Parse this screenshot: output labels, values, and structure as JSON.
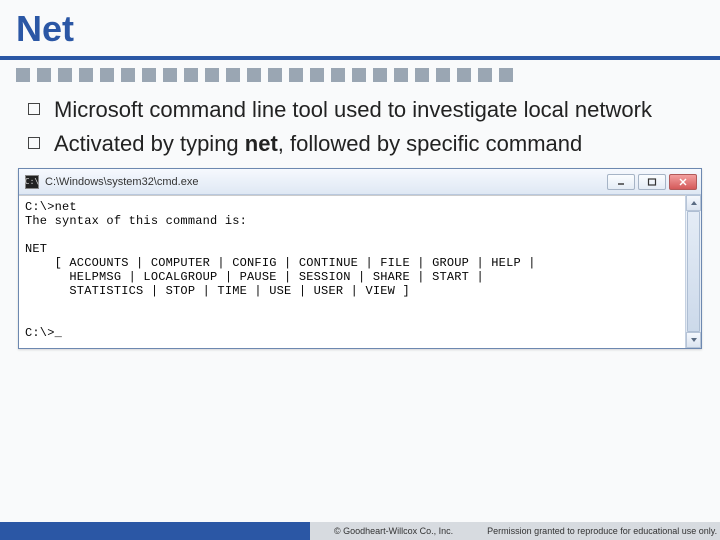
{
  "title": "Net",
  "decor": {
    "dot_count": 24
  },
  "bullets": [
    {
      "text": "Microsoft command line tool used to investigate local network"
    },
    {
      "text_pre": "Activated by typing ",
      "text_bold": "net",
      "text_post": ", followed by specific command"
    }
  ],
  "cmd": {
    "icon_glyph": "C:\\",
    "path": "C:\\Windows\\system32\\cmd.exe",
    "output": "C:\\>net\nThe syntax of this command is:\n\nNET\n    [ ACCOUNTS | COMPUTER | CONFIG | CONTINUE | FILE | GROUP | HELP |\n      HELPMSG | LOCALGROUP | PAUSE | SESSION | SHARE | START |\n      STATISTICS | STOP | TIME | USE | USER | VIEW ]\n\n\nC:\\>_"
  },
  "footer": {
    "copyright": "© Goodheart-Willcox Co., Inc.",
    "permission": "Permission granted to reproduce for educational use only."
  }
}
